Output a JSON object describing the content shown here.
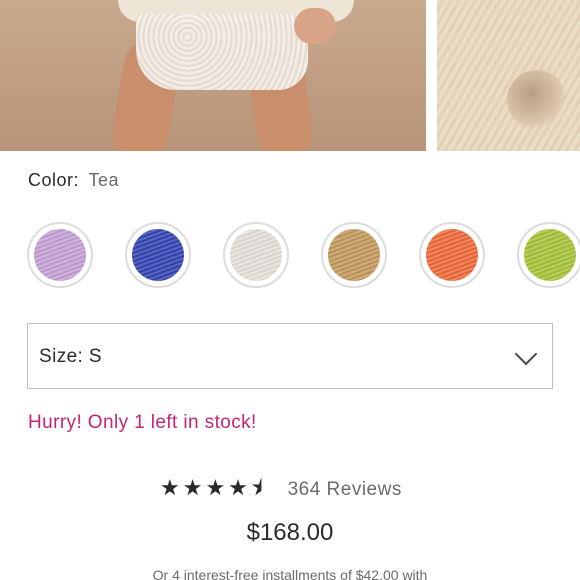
{
  "product": {
    "color_label": "Color:",
    "color_value": "Tea",
    "swatches": [
      {
        "name": "lavender",
        "color": "#c6a2d6"
      },
      {
        "name": "royal-blue",
        "color": "#3646b4"
      },
      {
        "name": "ivory",
        "color": "#e3e1d9"
      },
      {
        "name": "camel",
        "color": "#c49a5c"
      },
      {
        "name": "orange",
        "color": "#f06b3c"
      },
      {
        "name": "lime",
        "color": "#a8c53a"
      }
    ],
    "size_select": {
      "text": "Size: S",
      "icon": "chevron-down-icon"
    },
    "stock_message": "Hurry! Only 1 left in stock!",
    "rating": {
      "stars_display": "★★★★⯨",
      "value": 4.5,
      "reviews_text": "364 Reviews"
    },
    "price": "$168.00",
    "installments_text": "Or 4 interest-free installments of $42.00 with"
  },
  "colors": {
    "accent_pink": "#c4256f",
    "text": "#2b2b2b",
    "muted": "#6b6b6b"
  }
}
